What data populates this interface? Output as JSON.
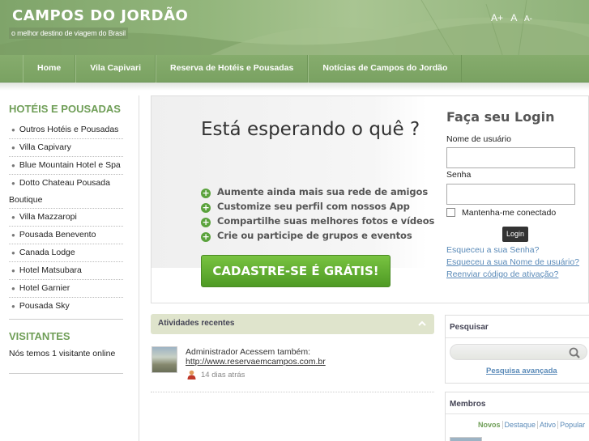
{
  "header": {
    "title": "CAMPOS DO JORDÃO",
    "tagline": "o melhor destino de viagem do Brasil",
    "font_size_controls": [
      "A+",
      "A",
      "A-"
    ]
  },
  "nav": {
    "items": [
      "Home",
      "Vila Capivari",
      "Reserva de Hotéis e Pousadas",
      "Notícias de Campos do Jordão"
    ]
  },
  "sidebar": {
    "hotels_heading": "HOTÉIS E POUSADAS",
    "hotels": [
      "Outros Hotéis e Pousadas",
      "Villa Capivary",
      "Blue Mountain Hotel e Spa",
      "Dotto Chateau Pousada",
      "Boutique",
      "Villa Mazzaropi",
      "Pousada Benevento",
      "Canada Lodge",
      "Hotel Matsubara",
      "Hotel Garnier",
      "Pousada Sky"
    ],
    "visitors_heading": "VISITANTES",
    "visitors_text": "Nós temos 1 visitante online"
  },
  "promo": {
    "title": "Está esperando o quê ?",
    "features": [
      "Aumente ainda mais sua rede de amigos",
      "Customize seu perfil com nossos App",
      "Compartilhe suas melhores fotos e vídeos",
      "Crie ou participe de grupos e eventos"
    ],
    "signup_label": "CADASTRE-SE É GRÁTIS!"
  },
  "login": {
    "title": "Faça seu Login",
    "username_label": "Nome de usuário",
    "password_label": "Senha",
    "remember_label": "Mantenha-me conectado",
    "button_label": "Login",
    "forgot_password": "Esqueceu a sua Senha?",
    "forgot_username": "Esqueceu a sua Nome de usuário?",
    "resend_activation": "Reenviar código de ativação?"
  },
  "activities": {
    "title": "Atividades recentes",
    "items": [
      {
        "text": "Administrador Acessem também:",
        "link": "http://www.reservaemcampos.com.br",
        "time": "14 dias atrás"
      }
    ]
  },
  "search": {
    "title": "Pesquisar",
    "advanced_link": "Pesquisa avançada"
  },
  "members": {
    "title": "Membros",
    "tabs": [
      "Novos",
      "Destaque",
      "Ativo",
      "Popular"
    ]
  },
  "colors": {
    "header_green": "#8fb27a",
    "heading_green": "#6f9e57",
    "link_blue": "#5a8ab8",
    "button_green": "#5aa23c"
  }
}
